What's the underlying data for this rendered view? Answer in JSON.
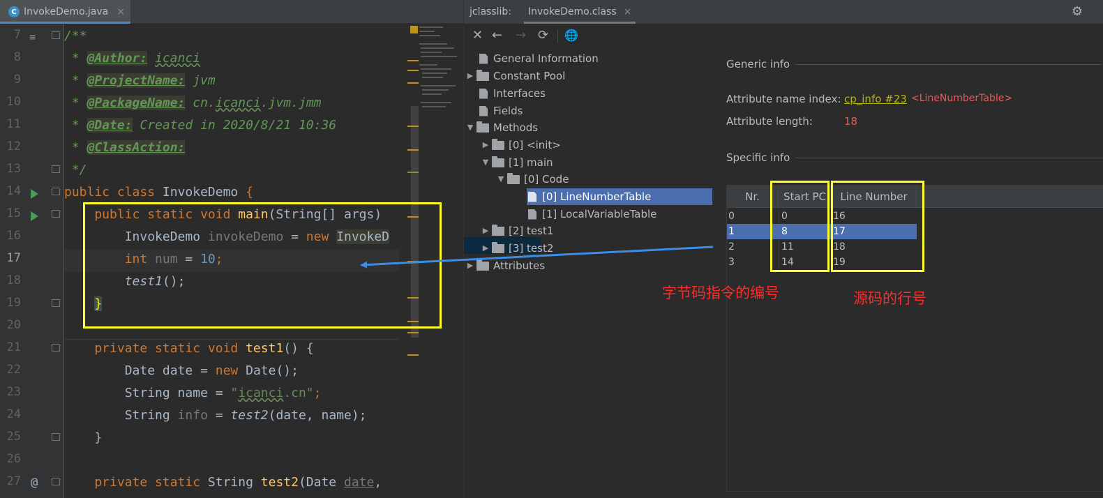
{
  "editor": {
    "tab": {
      "icon": "C",
      "label": "InvokeDemo.java",
      "close": "×"
    },
    "line_numbers": [
      "7",
      "8",
      "9",
      "10",
      "11",
      "12",
      "13",
      "14",
      "15",
      "16",
      "17",
      "18",
      "19",
      "20",
      "21",
      "22",
      "23",
      "24",
      "25",
      "26",
      "27"
    ],
    "code": {
      "l7_open": "/**",
      "l8_star": " * ",
      "l8_tag": "@Author:",
      "l8_val": "icanci",
      "l9_star": " * ",
      "l9_tag": "@ProjectName:",
      "l9_val": " jvm",
      "l10_star": " * ",
      "l10_tag": "@PackageName:",
      "l10_val_a": " cn.",
      "l10_val_b": "icanci",
      "l10_val_c": ".jvm.jmm",
      "l11_star": " * ",
      "l11_tag": "@Date:",
      "l11_val": " Created in 2020/8/21 10:36",
      "l12_star": " * ",
      "l12_tag": "@ClassAction:",
      "l13": " */",
      "l14_kw": "public class ",
      "l14_name": "InvokeDemo ",
      "l14_brace": "{",
      "l15_kw": "    public static void ",
      "l15_fn": "main",
      "l15_rest": "(String[] args)",
      "l16_type": "        InvokeDemo ",
      "l16_var": "invokeDemo",
      "l16_eq": " = ",
      "l16_new": "new ",
      "l16_ctor": "InvokeD",
      "l17_kw": "        int ",
      "l17_var": "num",
      "l17_eq": " = ",
      "l17_num": "10",
      "l17_semi": ";",
      "l18_call": "        test1",
      "l18_rest": "();",
      "l19_indent": "    ",
      "l19_brace": "}",
      "l21_kw": "    private static void ",
      "l21_fn": "test1",
      "l21_rest": "() {",
      "l22_a": "        Date date = ",
      "l22_new": "new ",
      "l22_b": "Date();",
      "l23_a": "        String name = ",
      "l23_q1": "\"",
      "l23_s": "icanci",
      "l23_q2": ".cn\"",
      "l23_semi": ";",
      "l24_a": "        String ",
      "l24_var": "info",
      "l24_eq": " = ",
      "l24_call": "test2",
      "l24_rest": "(date, name);",
      "l25": "    }",
      "l27_kw": "    private static ",
      "l27_type": "String ",
      "l27_fn": "test2",
      "l27_rest": "(Date ",
      "l27_param": "date",
      "l27_comma": ","
    }
  },
  "jclasslib": {
    "label": "jclasslib:",
    "tab": "InvokeDemo.class",
    "close": "×",
    "toolbar": {
      "close": "✕",
      "back": "←",
      "forward": "→",
      "refresh": "⟳",
      "web": "🌐",
      "settings": "⚙"
    },
    "tree": [
      {
        "label": "General Information"
      },
      {
        "label": "Constant Pool"
      },
      {
        "label": "Interfaces"
      },
      {
        "label": "Fields"
      },
      {
        "label": "Methods"
      },
      {
        "label": "[0] <init>"
      },
      {
        "label": "[1] main"
      },
      {
        "label": "[0] Code"
      },
      {
        "label": "[0] LineNumberTable"
      },
      {
        "label": "[1] LocalVariableTable"
      },
      {
        "label": "[2] test1"
      },
      {
        "label": "[3] test2"
      },
      {
        "label": "Attributes"
      }
    ],
    "generic_info": {
      "title": "Generic info",
      "name_index_label": "Attribute name index:",
      "name_index_link": "cp_info #23",
      "name_index_value": "<LineNumberTable>",
      "length_label": "Attribute length:",
      "length_value": "18"
    },
    "specific_info": {
      "title": "Specific info",
      "columns": [
        "Nr.",
        "Start PC",
        "Line Number"
      ],
      "rows": [
        {
          "nr": "0",
          "pc": "0",
          "line": "16"
        },
        {
          "nr": "1",
          "pc": "8",
          "line": "17"
        },
        {
          "nr": "2",
          "pc": "11",
          "line": "18"
        },
        {
          "nr": "3",
          "pc": "14",
          "line": "19"
        }
      ],
      "selected_row": 1
    }
  },
  "annotations": {
    "bytecode_label": "字节码指令的编号",
    "source_line_label": "源码的行号",
    "highlight_color": "#ffff2e",
    "arrow_color": "#3a8ee6",
    "text_color": "#ff2a2a"
  }
}
